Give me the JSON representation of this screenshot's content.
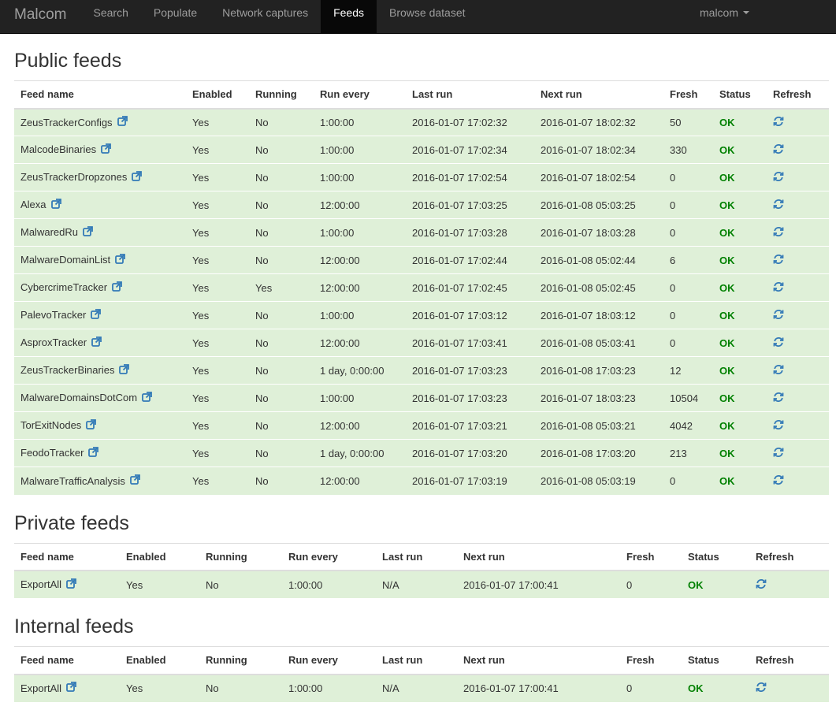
{
  "nav": {
    "brand": "Malcom",
    "items": [
      "Search",
      "Populate",
      "Network captures",
      "Feeds",
      "Browse dataset"
    ],
    "active": "Feeds",
    "user": "malcom"
  },
  "colors": {
    "row_bg": "#dff0d8",
    "ok": "#008000",
    "icon": "#337ab7",
    "navbar": "#222222"
  },
  "columns": [
    "Feed name",
    "Enabled",
    "Running",
    "Run every",
    "Last run",
    "Next run",
    "Fresh",
    "Status",
    "Refresh"
  ],
  "sections": {
    "public": {
      "title": "Public feeds",
      "rows": [
        {
          "name": "ZeusTrackerConfigs",
          "enabled": "Yes",
          "running": "No",
          "run_every": "1:00:00",
          "last_run": "2016-01-07 17:02:32",
          "next_run": "2016-01-07 18:02:32",
          "fresh": "50",
          "status": "OK"
        },
        {
          "name": "MalcodeBinaries",
          "enabled": "Yes",
          "running": "No",
          "run_every": "1:00:00",
          "last_run": "2016-01-07 17:02:34",
          "next_run": "2016-01-07 18:02:34",
          "fresh": "330",
          "status": "OK"
        },
        {
          "name": "ZeusTrackerDropzones",
          "enabled": "Yes",
          "running": "No",
          "run_every": "1:00:00",
          "last_run": "2016-01-07 17:02:54",
          "next_run": "2016-01-07 18:02:54",
          "fresh": "0",
          "status": "OK"
        },
        {
          "name": "Alexa",
          "enabled": "Yes",
          "running": "No",
          "run_every": "12:00:00",
          "last_run": "2016-01-07 17:03:25",
          "next_run": "2016-01-08 05:03:25",
          "fresh": "0",
          "status": "OK"
        },
        {
          "name": "MalwaredRu",
          "enabled": "Yes",
          "running": "No",
          "run_every": "1:00:00",
          "last_run": "2016-01-07 17:03:28",
          "next_run": "2016-01-07 18:03:28",
          "fresh": "0",
          "status": "OK"
        },
        {
          "name": "MalwareDomainList",
          "enabled": "Yes",
          "running": "No",
          "run_every": "12:00:00",
          "last_run": "2016-01-07 17:02:44",
          "next_run": "2016-01-08 05:02:44",
          "fresh": "6",
          "status": "OK"
        },
        {
          "name": "CybercrimeTracker",
          "enabled": "Yes",
          "running": "Yes",
          "run_every": "12:00:00",
          "last_run": "2016-01-07 17:02:45",
          "next_run": "2016-01-08 05:02:45",
          "fresh": "0",
          "status": "OK"
        },
        {
          "name": "PalevoTracker",
          "enabled": "Yes",
          "running": "No",
          "run_every": "1:00:00",
          "last_run": "2016-01-07 17:03:12",
          "next_run": "2016-01-07 18:03:12",
          "fresh": "0",
          "status": "OK"
        },
        {
          "name": "AsproxTracker",
          "enabled": "Yes",
          "running": "No",
          "run_every": "12:00:00",
          "last_run": "2016-01-07 17:03:41",
          "next_run": "2016-01-08 05:03:41",
          "fresh": "0",
          "status": "OK"
        },
        {
          "name": "ZeusTrackerBinaries",
          "enabled": "Yes",
          "running": "No",
          "run_every": "1 day, 0:00:00",
          "last_run": "2016-01-07 17:03:23",
          "next_run": "2016-01-08 17:03:23",
          "fresh": "12",
          "status": "OK"
        },
        {
          "name": "MalwareDomainsDotCom",
          "enabled": "Yes",
          "running": "No",
          "run_every": "1:00:00",
          "last_run": "2016-01-07 17:03:23",
          "next_run": "2016-01-07 18:03:23",
          "fresh": "10504",
          "status": "OK"
        },
        {
          "name": "TorExitNodes",
          "enabled": "Yes",
          "running": "No",
          "run_every": "12:00:00",
          "last_run": "2016-01-07 17:03:21",
          "next_run": "2016-01-08 05:03:21",
          "fresh": "4042",
          "status": "OK"
        },
        {
          "name": "FeodoTracker",
          "enabled": "Yes",
          "running": "No",
          "run_every": "1 day, 0:00:00",
          "last_run": "2016-01-07 17:03:20",
          "next_run": "2016-01-08 17:03:20",
          "fresh": "213",
          "status": "OK"
        },
        {
          "name": "MalwareTrafficAnalysis",
          "enabled": "Yes",
          "running": "No",
          "run_every": "12:00:00",
          "last_run": "2016-01-07 17:03:19",
          "next_run": "2016-01-08 05:03:19",
          "fresh": "0",
          "status": "OK"
        }
      ]
    },
    "private": {
      "title": "Private feeds",
      "rows": [
        {
          "name": "ExportAll",
          "enabled": "Yes",
          "running": "No",
          "run_every": "1:00:00",
          "last_run": "N/A",
          "next_run": "2016-01-07 17:00:41",
          "fresh": "0",
          "status": "OK"
        }
      ]
    },
    "internal": {
      "title": "Internal feeds",
      "rows": [
        {
          "name": "ExportAll",
          "enabled": "Yes",
          "running": "No",
          "run_every": "1:00:00",
          "last_run": "N/A",
          "next_run": "2016-01-07 17:00:41",
          "fresh": "0",
          "status": "OK"
        }
      ]
    }
  }
}
